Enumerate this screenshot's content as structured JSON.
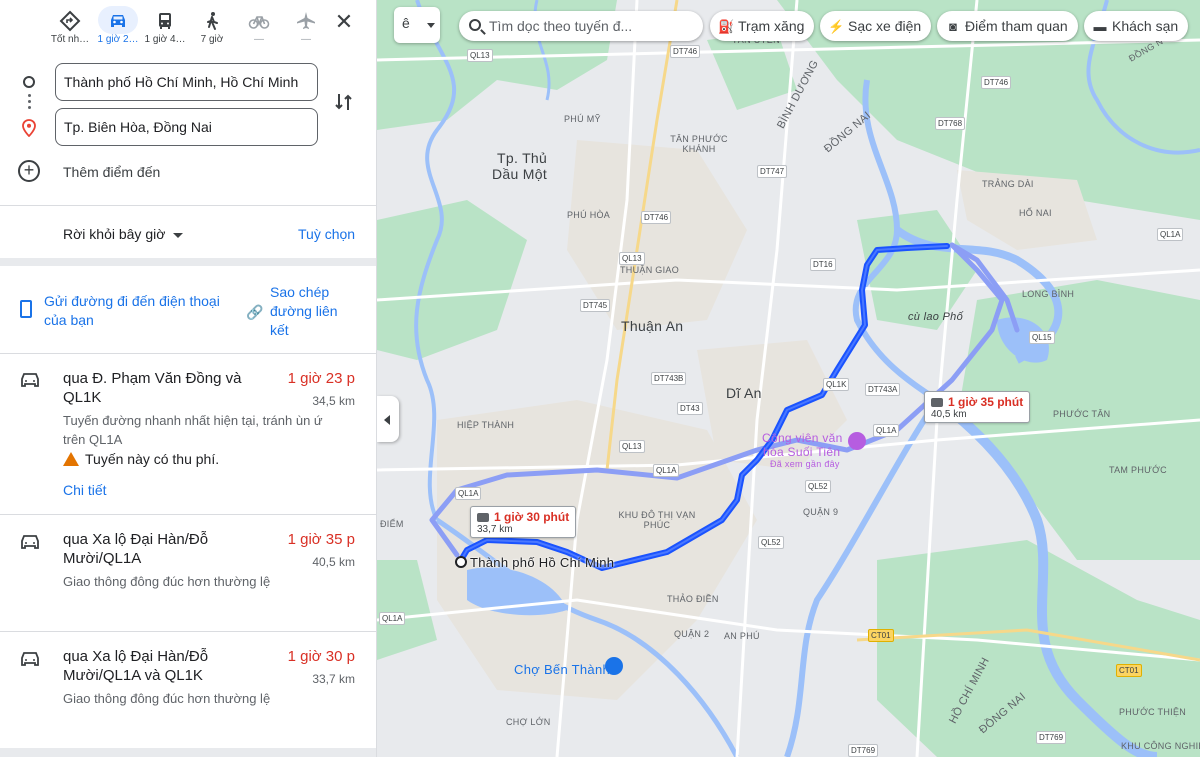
{
  "travel_modes": [
    {
      "label": "Tốt nh…",
      "icon": "best-route-icon"
    },
    {
      "label": "1 giờ 2…",
      "icon": "car-icon"
    },
    {
      "label": "1 giờ 4…",
      "icon": "bus-icon"
    },
    {
      "label": "7 giờ",
      "icon": "walk-icon"
    },
    {
      "label": "—",
      "icon": "bicycle-icon"
    },
    {
      "label": "—",
      "icon": "flight-icon"
    }
  ],
  "origin": "Thành phố Hồ Chí Minh, Hồ Chí Minh",
  "destination": "Tp. Biên Hòa, Đồng Nai",
  "add_destination": "Thêm điểm đến",
  "depart_label": "Rời khỏi bây giờ",
  "options_label": "Tuỳ chọn",
  "share_phone_label": "Gửi đường đi đến điện thoại của bạn",
  "copy_link_label": "Sao chép đường liên kết",
  "routes": [
    {
      "title": "qua Đ. Phạm Văn Đồng và QL1K",
      "time": "1 giờ 23 p",
      "distance": "34,5 km",
      "description": "Tuyến đường nhanh nhất hiện tại, tránh ùn ứ trên QL1A",
      "toll": "Tuyến này có thu phí.",
      "details": "Chi tiết"
    },
    {
      "title": "qua Xa lộ Đại Hàn/Đỗ Mười/QL1A",
      "time": "1 giờ 35 p",
      "distance": "40,5 km",
      "description": "Giao thông đông đúc hơn thường lệ"
    },
    {
      "title": "qua Xa lộ Đại Hàn/Đỗ Mười/QL1A và QL1K",
      "time": "1 giờ 30 p",
      "distance": "33,7 km",
      "description": "Giao thông đông đúc hơn thường lệ"
    }
  ],
  "map": {
    "layer_glyph": "ê",
    "search_placeholder": "Tìm dọc theo tuyến đ...",
    "chips": [
      "Trạm xăng",
      "Sạc xe điện",
      "Điểm tham quan",
      "Khách sạn"
    ],
    "callouts": [
      {
        "time": "1 giờ 35 phút",
        "distance": "40,5 km"
      },
      {
        "time": "1 giờ 30 phút",
        "distance": "33,7 km"
      }
    ],
    "cities": {
      "thu_dau_mot_1": "Tp. Thủ",
      "thu_dau_mot_2": "Dầu Một",
      "thuan_an": "Thuận An",
      "di_an": "Dĩ An",
      "origin_label": "Thành phố Hồ Chí Minh",
      "ben_thanh": "Chợ Bến Thành",
      "suoi_tien_1": "Công viên văn",
      "suoi_tien_2": "hóa Suối Tiên",
      "suoi_tien_3": "Đã xem gần đây",
      "cu_lao_pho": "cù lao Phố"
    },
    "areas": [
      "TÂN UYÊN",
      "PHÚ MỸ",
      "TÂN PHƯỚC KHÁNH",
      "PHÚ HÒA",
      "THUẬN GIAO",
      "TRẢNG DÀI",
      "HỐ NAI",
      "LONG BÌNH",
      "PHƯỚC TÂN",
      "TAM PHƯỚC",
      "HIỆP THÀNH",
      "KHU ĐÔ THỊ VẠN PHÚC",
      "QUẬN 9",
      "THẢO ĐIỀN",
      "QUẬN 2",
      "AN PHÚ",
      "CHỢ LỚN",
      "PHƯỚC THIỆN",
      "KHU CÔNG NGHIỆP",
      "ĐIỂM",
      "ĐỒNG N"
    ],
    "rotated": [
      "BÌNH DƯƠNG",
      "ĐỒNG NAI",
      "HỒ CHÍ MINH",
      "ĐỒNG NAI"
    ],
    "road_badges": [
      "QL13",
      "DT746",
      "DT746",
      "DT768",
      "DT747",
      "DT746",
      "QL13",
      "DT16",
      "DT745",
      "QL1A",
      "QL15",
      "QL1K",
      "DT743A",
      "DT743B",
      "DT43",
      "QL1A",
      "QL13",
      "QL1A",
      "QL1A",
      "QL52",
      "QL52",
      "CT01",
      "CT01",
      "DT769",
      "DT769",
      "QL1A"
    ],
    "colors": {
      "route_primary": "#1a53ff",
      "route_alt": "#8c9ef5",
      "water": "#9cc0f9",
      "green": "#b9e3c6",
      "urban": "#e8e6e1"
    }
  }
}
